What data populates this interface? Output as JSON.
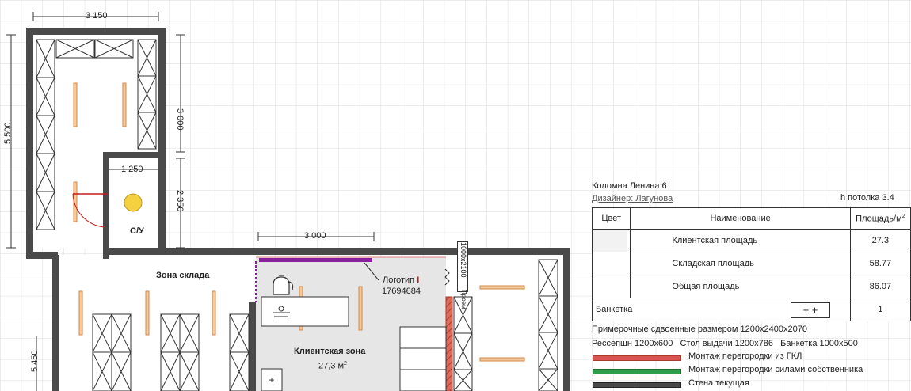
{
  "plan": {
    "dimensions": {
      "top_width": "3 150",
      "left_height_upper": "5 500",
      "right_upper": "3 000",
      "bathroom_width": "1 250",
      "right_middle": "2 350",
      "client_width": "3 000",
      "left_height_lower": "5 450",
      "doorway": "1000x2100"
    },
    "rooms": {
      "bathroom_label": "С/У",
      "warehouse_label": "Зона склада",
      "client_label": "Клиентская зона",
      "client_area_value": "27,3 м",
      "client_area_sup": "2"
    },
    "logo": {
      "label": "Логотип",
      "code": "17694684"
    },
    "doorway_word": "Проем"
  },
  "info": {
    "address": "Коломна Ленина 6",
    "designer": "Дизайнер: Лагунова",
    "ceiling": "h потолка 3.4"
  },
  "table": {
    "headers": {
      "color": "Цвет",
      "name": "Наименование",
      "area": "Площадь/м",
      "area_sup": "2"
    },
    "rows": [
      {
        "name": "Клиентская площадь",
        "value": "27.3",
        "swatch": "#f2f2f2"
      },
      {
        "name": "Складская площадь",
        "value": "58.77"
      },
      {
        "name": "Общая площадь",
        "value": "86.07"
      }
    ],
    "bench": {
      "name": "Банкетка",
      "value": "1",
      "icon": "bench-plus-plus-icon"
    }
  },
  "notes": {
    "line1": "Примерочные сдвоенные размером 1200х2400х2070",
    "line2": "Рессепшн 1200х600   Стол выдачи 1200х786   Банкетка 1000х500"
  },
  "legend": [
    {
      "label": "Монтаж перегородки из ГКЛ",
      "color": "#d9534f"
    },
    {
      "label": "Монтаж перегородки силами собственника",
      "color": "#2e9e4a"
    },
    {
      "label": "Стена текущая",
      "color": "#4a4a4a"
    }
  ]
}
